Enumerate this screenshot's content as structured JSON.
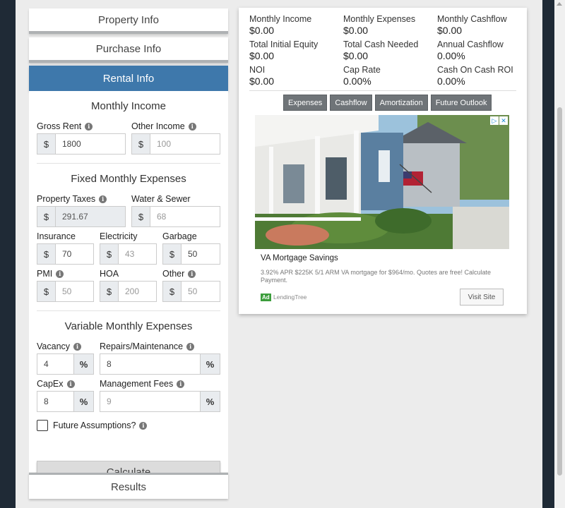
{
  "accordion": {
    "property_info": "Property Info",
    "purchase_info": "Purchase Info",
    "rental_info": "Rental Info",
    "results": "Results"
  },
  "monthly_income": {
    "title": "Monthly Income",
    "gross_rent": {
      "label": "Gross Rent",
      "prefix": "$",
      "value": "1800"
    },
    "other_income": {
      "label": "Other Income",
      "prefix": "$",
      "placeholder": "100"
    }
  },
  "fixed_expenses": {
    "title": "Fixed Monthly Expenses",
    "property_taxes": {
      "label": "Property Taxes",
      "prefix": "$",
      "value": "291.67"
    },
    "water_sewer": {
      "label": "Water & Sewer",
      "prefix": "$",
      "placeholder": "68"
    },
    "insurance": {
      "label": "Insurance",
      "prefix": "$",
      "value": "70"
    },
    "electricity": {
      "label": "Electricity",
      "prefix": "$",
      "placeholder": "43"
    },
    "garbage": {
      "label": "Garbage",
      "prefix": "$",
      "value": "50"
    },
    "pmi": {
      "label": "PMI",
      "prefix": "$",
      "placeholder": "50"
    },
    "hoa": {
      "label": "HOA",
      "prefix": "$",
      "placeholder": "200"
    },
    "other": {
      "label": "Other",
      "prefix": "$",
      "placeholder": "50"
    }
  },
  "variable_expenses": {
    "title": "Variable Monthly Expenses",
    "vacancy": {
      "label": "Vacancy",
      "suffix": "%",
      "value": "4"
    },
    "repairs": {
      "label": "Repairs/Maintenance",
      "suffix": "%",
      "value": "8"
    },
    "capex": {
      "label": "CapEx",
      "suffix": "%",
      "value": "8"
    },
    "management": {
      "label": "Management Fees",
      "suffix": "%",
      "placeholder": "9"
    }
  },
  "future_assumptions": {
    "label": "Future Assumptions?",
    "checked": false
  },
  "calculate_label": "Calculate",
  "summary": [
    {
      "label": "Monthly Income",
      "value": "$0.00"
    },
    {
      "label": "Monthly Expenses",
      "value": "$0.00"
    },
    {
      "label": "Monthly Cashflow",
      "value": "$0.00"
    },
    {
      "label": "Total Initial Equity",
      "value": "$0.00"
    },
    {
      "label": "Total Cash Needed",
      "value": "$0.00"
    },
    {
      "label": "Annual Cashflow",
      "value": "0.00%"
    },
    {
      "label": "NOI",
      "value": "$0.00"
    },
    {
      "label": "Cap Rate",
      "value": "0.00%"
    },
    {
      "label": "Cash On Cash ROI",
      "value": "0.00%"
    }
  ],
  "tabs": [
    "Expenses",
    "Cashflow",
    "Amortization",
    "Future Outlook"
  ],
  "ad": {
    "title": "VA Mortgage Savings",
    "text": "3.92% APR $225K 5/1 ARM VA mortgage for $964/mo. Quotes are free! Calculate Payment.",
    "badge": "Ad",
    "source": "LendingTree",
    "button": "Visit Site",
    "info_glyph": "▷",
    "close_glyph": "✕"
  },
  "icons": {
    "info": "i"
  }
}
